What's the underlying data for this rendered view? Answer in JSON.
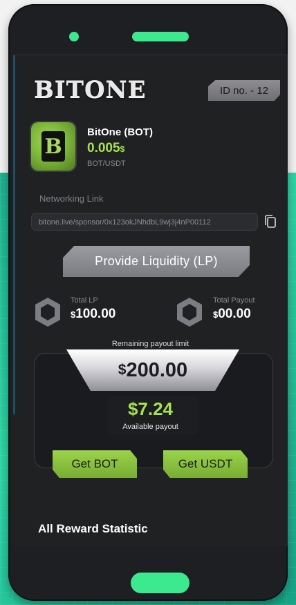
{
  "app": {
    "logo_text": "BITONE",
    "id_badge": "ID no. - 12"
  },
  "token": {
    "name": "BitOne (BOT)",
    "price": "0.005",
    "price_unit": "$",
    "pair": "BOT/USDT",
    "glyph": "B"
  },
  "networking": {
    "label": "Networking Link",
    "link": "bitone.live/sponsor/0x123okJNhdbL9wj3j4nP00112",
    "copy_icon": "copy-icon"
  },
  "actions": {
    "provide_liquidity": "Provide Liquidity (LP)"
  },
  "stats": {
    "total_lp_label": "Total LP",
    "total_lp_currency": "$",
    "total_lp_value": "100.00",
    "total_payout_label": "Total Payout",
    "total_payout_currency": "$",
    "total_payout_value": "00.00"
  },
  "payout": {
    "remaining_label": "Remaining payout limit",
    "remaining_currency": "$",
    "remaining_value": "200.00",
    "available_value": "$7.24",
    "available_label": "Available payout",
    "get_bot": "Get BOT",
    "get_usdt": "Get USDT"
  },
  "section": {
    "title": "All Reward Statistic"
  },
  "colors": {
    "accent_green": "#a6e34f",
    "device_green": "#3ce98e",
    "teal_background": "#2dd6a6",
    "screen_bg": "#202123"
  }
}
